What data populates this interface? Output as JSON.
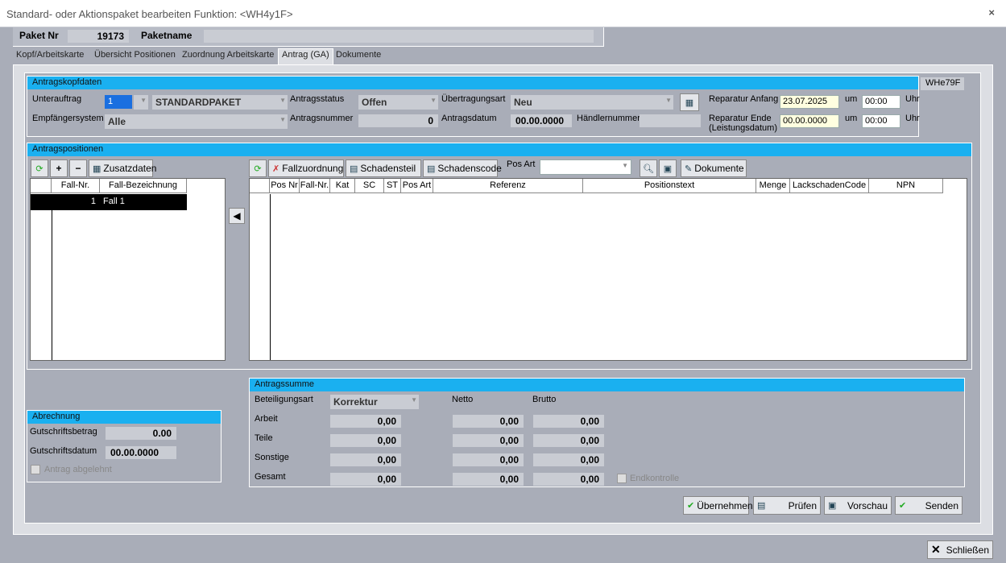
{
  "window": {
    "title": "Standard- oder Aktionspaket bearbeiten   Funktion: <WH4y1F>",
    "close": "×"
  },
  "header": {
    "paket_nr_label": "Paket Nr",
    "paket_nr": "19173",
    "paketname_label": "Paketname",
    "paketname": ""
  },
  "tabs": [
    "Kopf/Arbeitskarte",
    "Übersicht Positionen",
    "Zuordnung Arbeitskarte",
    "Antrag (GA)",
    "Dokumente"
  ],
  "code": "WHe79F",
  "antragskopf": {
    "title": "Antragskopfdaten",
    "unterauftrag_label": "Unterauftrag",
    "unterauftrag": "1",
    "paket": "STANDARDPAKET",
    "antragsstatus_label": "Antragsstatus",
    "antragsstatus": "Offen",
    "uebertragungsart_label": "Übertragungsart",
    "uebertragungsart": "Neu",
    "reparatur_anfang_label": "Reparatur Anfang",
    "reparatur_anfang": "23.07.2025",
    "um": "um",
    "anfang_time": "00:00",
    "uhr": "Uhr",
    "empfaenger_label": "Empfängersystem",
    "empfaenger": "Alle",
    "antragsnummer_label": "Antragsnummer",
    "antragsnummer": "0",
    "antragsdatum_label": "Antragsdatum",
    "antragsdatum": "00.00.0000",
    "haendler_label": "Händlernummer",
    "haendler": "",
    "reparatur_ende_label": "Reparatur Ende",
    "reparatur_ende_sub": "(Leistungsdatum)",
    "reparatur_ende": "00.00.0000",
    "ende_time": "00:00"
  },
  "positionen": {
    "title": "Antragspositionen",
    "zusatzdaten": "Zusatzdaten",
    "fall_cols": [
      "Fall-Nr.",
      "Fall-Bezeichnung"
    ],
    "fall_row": {
      "nr": "1",
      "name": "Fall 1"
    },
    "fallzuordnung": "Fallzuordnung",
    "schadensteil": "Schadensteil",
    "schadenscode": "Schadenscode",
    "pos_art_label": "Pos Art",
    "dokumente": "Dokumente",
    "cols": [
      "Pos Nr",
      "Fall-Nr.",
      "Kat",
      "SC",
      "ST",
      "Pos Art",
      "Referenz",
      "Positionstext",
      "Menge",
      "LackschadenCode",
      "NPN"
    ]
  },
  "summe": {
    "title": "Antragssumme",
    "beteiligungsart_label": "Beteiligungsart",
    "beteiligungsart": "Korrektur",
    "netto": "Netto",
    "brutto": "Brutto",
    "rows": [
      {
        "label": "Arbeit",
        "a": "0,00",
        "n": "0,00",
        "b": "0,00"
      },
      {
        "label": "Teile",
        "a": "0,00",
        "n": "0,00",
        "b": "0,00"
      },
      {
        "label": "Sonstige",
        "a": "0,00",
        "n": "0,00",
        "b": "0,00"
      },
      {
        "label": "Gesamt",
        "a": "0,00",
        "n": "0,00",
        "b": "0,00"
      }
    ],
    "endkontrolle": "Endkontrolle"
  },
  "abrechnung": {
    "title": "Abrechnung",
    "gutschrift_label": "Gutschriftsbetrag",
    "gutschrift": "0.00",
    "datum_label": "Gutschriftsdatum",
    "datum": "00.00.0000",
    "abgelehnt": "Antrag abgelehnt"
  },
  "buttons": {
    "uebernehmen": "Übernehmen",
    "pruefen": "Prüfen",
    "vorschau": "Vorschau",
    "senden": "Senden",
    "schliessen": "Schließen"
  }
}
